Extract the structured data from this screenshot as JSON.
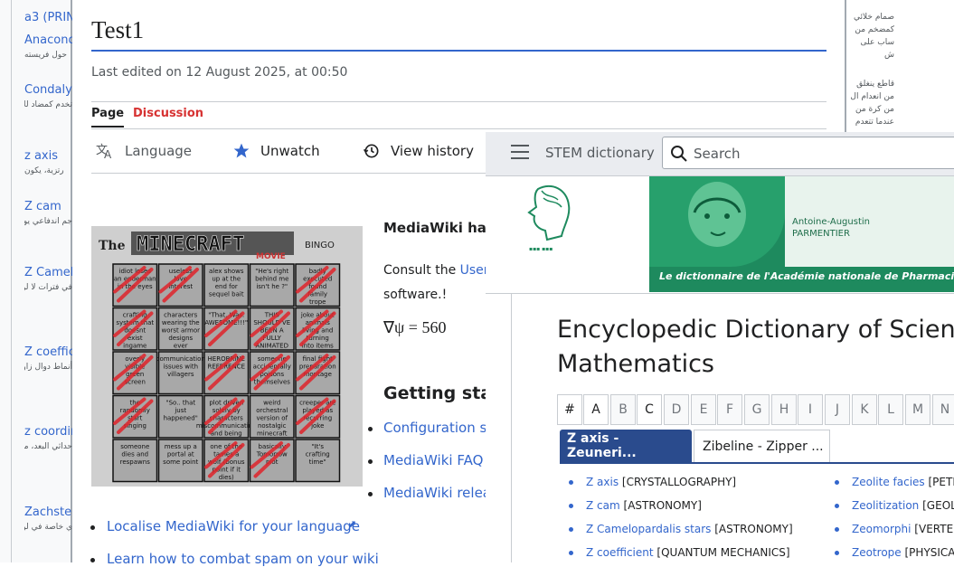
{
  "left_strip": {
    "items": [
      {
        "title": "a3 (PRIN",
        "snippet": ""
      },
      {
        "title": "Anacond",
        "snippet": "حول فريسته"
      },
      {
        "title": "Condaly",
        "snippet": "تخدم كمضاد للألم، يتم"
      },
      {
        "title": "z axis",
        "snippet": "رتزية، يكون"
      },
      {
        "title": "Z cam",
        "snippet": "جم اندفاعي يوم، وقدره"
      },
      {
        "title": "Z Camel",
        "snippet": "في فترات لا لولة جدًا، من الأعظم إلى"
      },
      {
        "title": "Z coeffic",
        "snippet": "أنماط دوال زاوية الثلاث، ين المصفوفة المشابهة له."
      },
      {
        "title": "z coordin",
        "snippet": "حداثي البعد، من نقطة إلى ادات مقيسة"
      },
      {
        "title": "Zachstei",
        "snippet": "ي خاصة في لوي (فوق"
      }
    ]
  },
  "main": {
    "title": "Test1",
    "last_edited": "Last edited on 12 August 2025, at 00:50",
    "tabs": {
      "page": "Page",
      "discussion": "Discussion"
    },
    "actions": {
      "language": "Language",
      "unwatch": "Unwatch",
      "view_history": "View history"
    },
    "bingo_image": {
      "title_the": "The",
      "title_main": "MINECRAFT",
      "title_movie": "MOVIE",
      "title_bingo": "BINGO",
      "cells": [
        "idiot loses an enderman in the eyes",
        "useless love interest",
        "alex shows up at the end for sequel bait",
        "\"He's right behind me isn't he ?\"",
        "badly executed found family trope",
        "crafting system that doesnt exist ingame",
        "characters wearing the worst armor designs ever",
        "\"That. Was. AWESOME!!!\"",
        "THIS SHOULD'VE BEEN A FULLY ANIMATED MOVIE",
        "joke about animals living and turning into items",
        "overly visible green screen",
        "communication issues with villagers",
        "HEROBRINE REFERENCE",
        "someone accidentally poisons themselves",
        "final fight preparation montage",
        "the randomly start singing",
        "\"So.. that just happened\"",
        "plot driven solely by characters miscommunicating and being dumb",
        "weird orchestral version of nostalgic minecraft music",
        "creeper are played as recurring joke",
        "someone dies and respawns",
        "mess up a portal at some point",
        "one of the tames a wolf (bonus point if it dies)",
        "basically Tomorrow plot",
        "\"It's crafting time\""
      ]
    },
    "mediawiki_heading": "MediaWiki has",
    "consult_text": "Consult the",
    "consult_link": "User",
    "consult_tail": "software.!",
    "formula": "∇ψ = 560",
    "getting_started": "Getting star",
    "links_right": [
      "Configuration se",
      "MediaWiki FAQ",
      "MediaWiki relea"
    ],
    "links_bottom": [
      "Localise MediaWiki for your language",
      "Learn how to combat spam on your wiki"
    ]
  },
  "right_strip": {
    "snippets": [
      "صمام خلائي كمضخم من ساب على ش",
      "قاطع ينغلق من انعدام ال من كرة من عندما تتعدم"
    ]
  },
  "overlay": {
    "site_name": "STEM dictionary",
    "search_placeholder": "Search",
    "banner_name": "Antoine-Augustin",
    "banner_surname": "PARMENTIER",
    "banner_caption": "Le dictionnaire de l'Académie nationale de Pharmacie",
    "ency_title_line1": "Encyclopedic Dictionary of Science",
    "ency_title_line2": "Mathematics",
    "letters": [
      "#",
      "A",
      "B",
      "C",
      "D",
      "E",
      "F",
      "G",
      "H",
      "I",
      "J",
      "K",
      "L",
      "M",
      "N"
    ],
    "active_letters": [
      "#",
      "A",
      "C"
    ],
    "range_tabs": [
      "Z axis - Zeuneri...",
      "Zibeline - Zipper ..."
    ],
    "entries_left": [
      {
        "term": "Z axis",
        "category": "[CRYSTALLOGRAPHY]"
      },
      {
        "term": "Z cam",
        "category": "[ASTRONOMY]"
      },
      {
        "term": "Z Camelopardalis stars",
        "category": "[ASTRONOMY]"
      },
      {
        "term": "Z coefficient",
        "category": "[QUANTUM MECHANICS]"
      }
    ],
    "entries_right": [
      {
        "term": "Zeolite facies",
        "category": "[PETR"
      },
      {
        "term": "Zeolitization",
        "category": "[GEOL"
      },
      {
        "term": "Zeomorphi",
        "category": "[VERTE"
      },
      {
        "term": "Zeotrope",
        "category": "[PHYSICA"
      }
    ],
    "colors": {
      "accent": "#2a4b8d",
      "banner_green": "#1e8a5e",
      "link": "#3366cc"
    }
  }
}
